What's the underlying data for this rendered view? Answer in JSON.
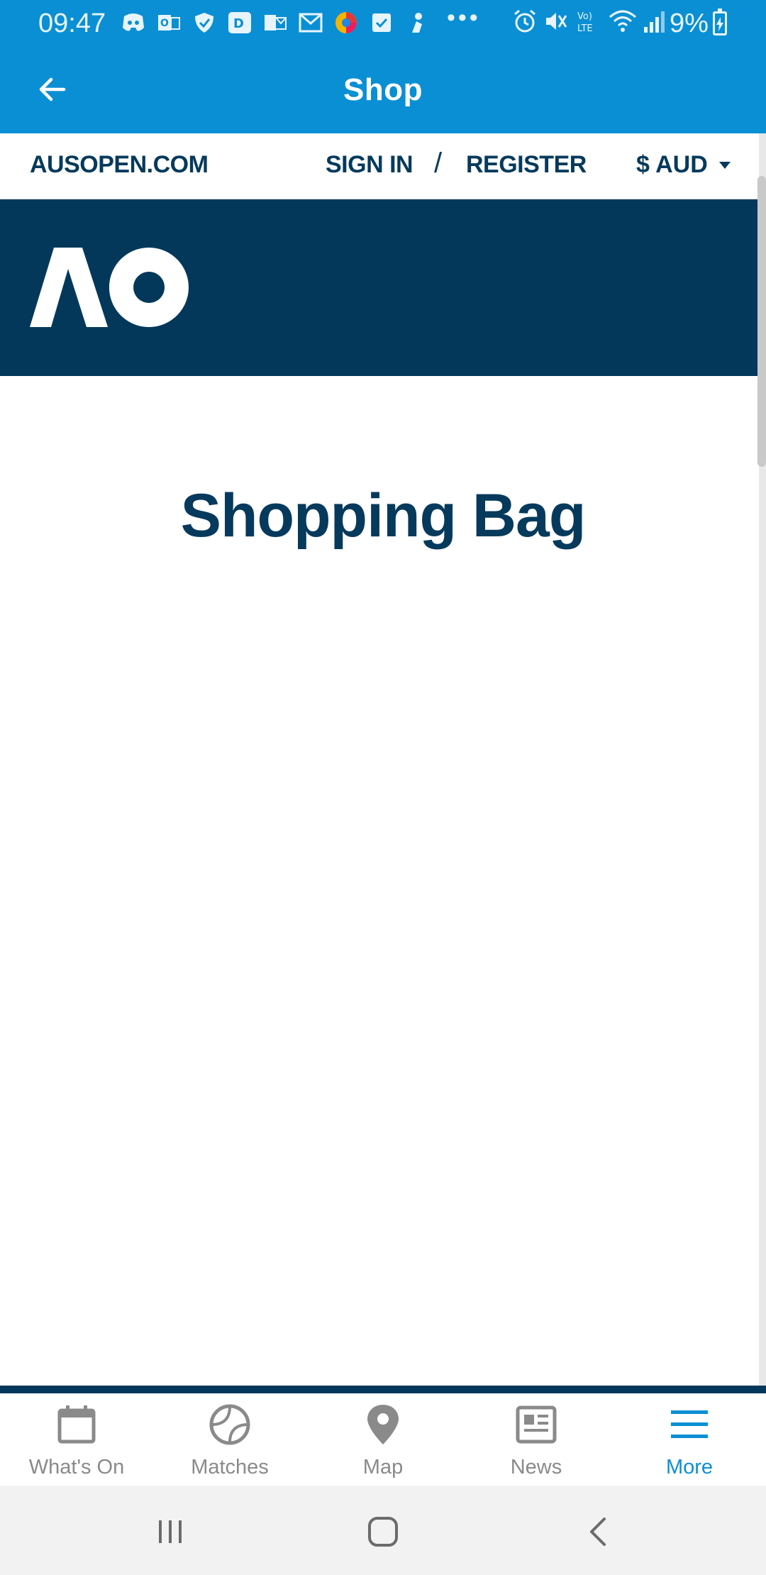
{
  "status_bar": {
    "time": "09:47",
    "battery_text": "9%",
    "dots": "•••"
  },
  "app_bar": {
    "title": "Shop",
    "back_icon": "arrow-left-icon"
  },
  "site_nav": {
    "home_link": "AUSOPEN.COM",
    "sign_in": "SIGN IN",
    "separator": "/",
    "register": "REGISTER",
    "currency": "$ AUD"
  },
  "brand": {
    "logo_text": "AO"
  },
  "main": {
    "heading": "Shopping Bag"
  },
  "bottom_nav": {
    "items": [
      {
        "label": "What's On",
        "icon": "calendar-icon",
        "active": false
      },
      {
        "label": "Matches",
        "icon": "tennis-ball-icon",
        "active": false
      },
      {
        "label": "Map",
        "icon": "map-pin-icon",
        "active": false
      },
      {
        "label": "News",
        "icon": "newspaper-icon",
        "active": false
      },
      {
        "label": "More",
        "icon": "menu-icon",
        "active": true
      }
    ]
  },
  "colors": {
    "primary_blue": "#0a8fd4",
    "navy": "#03385b",
    "text_navy": "#063a5c",
    "inactive_gray": "#8a8a8a"
  }
}
